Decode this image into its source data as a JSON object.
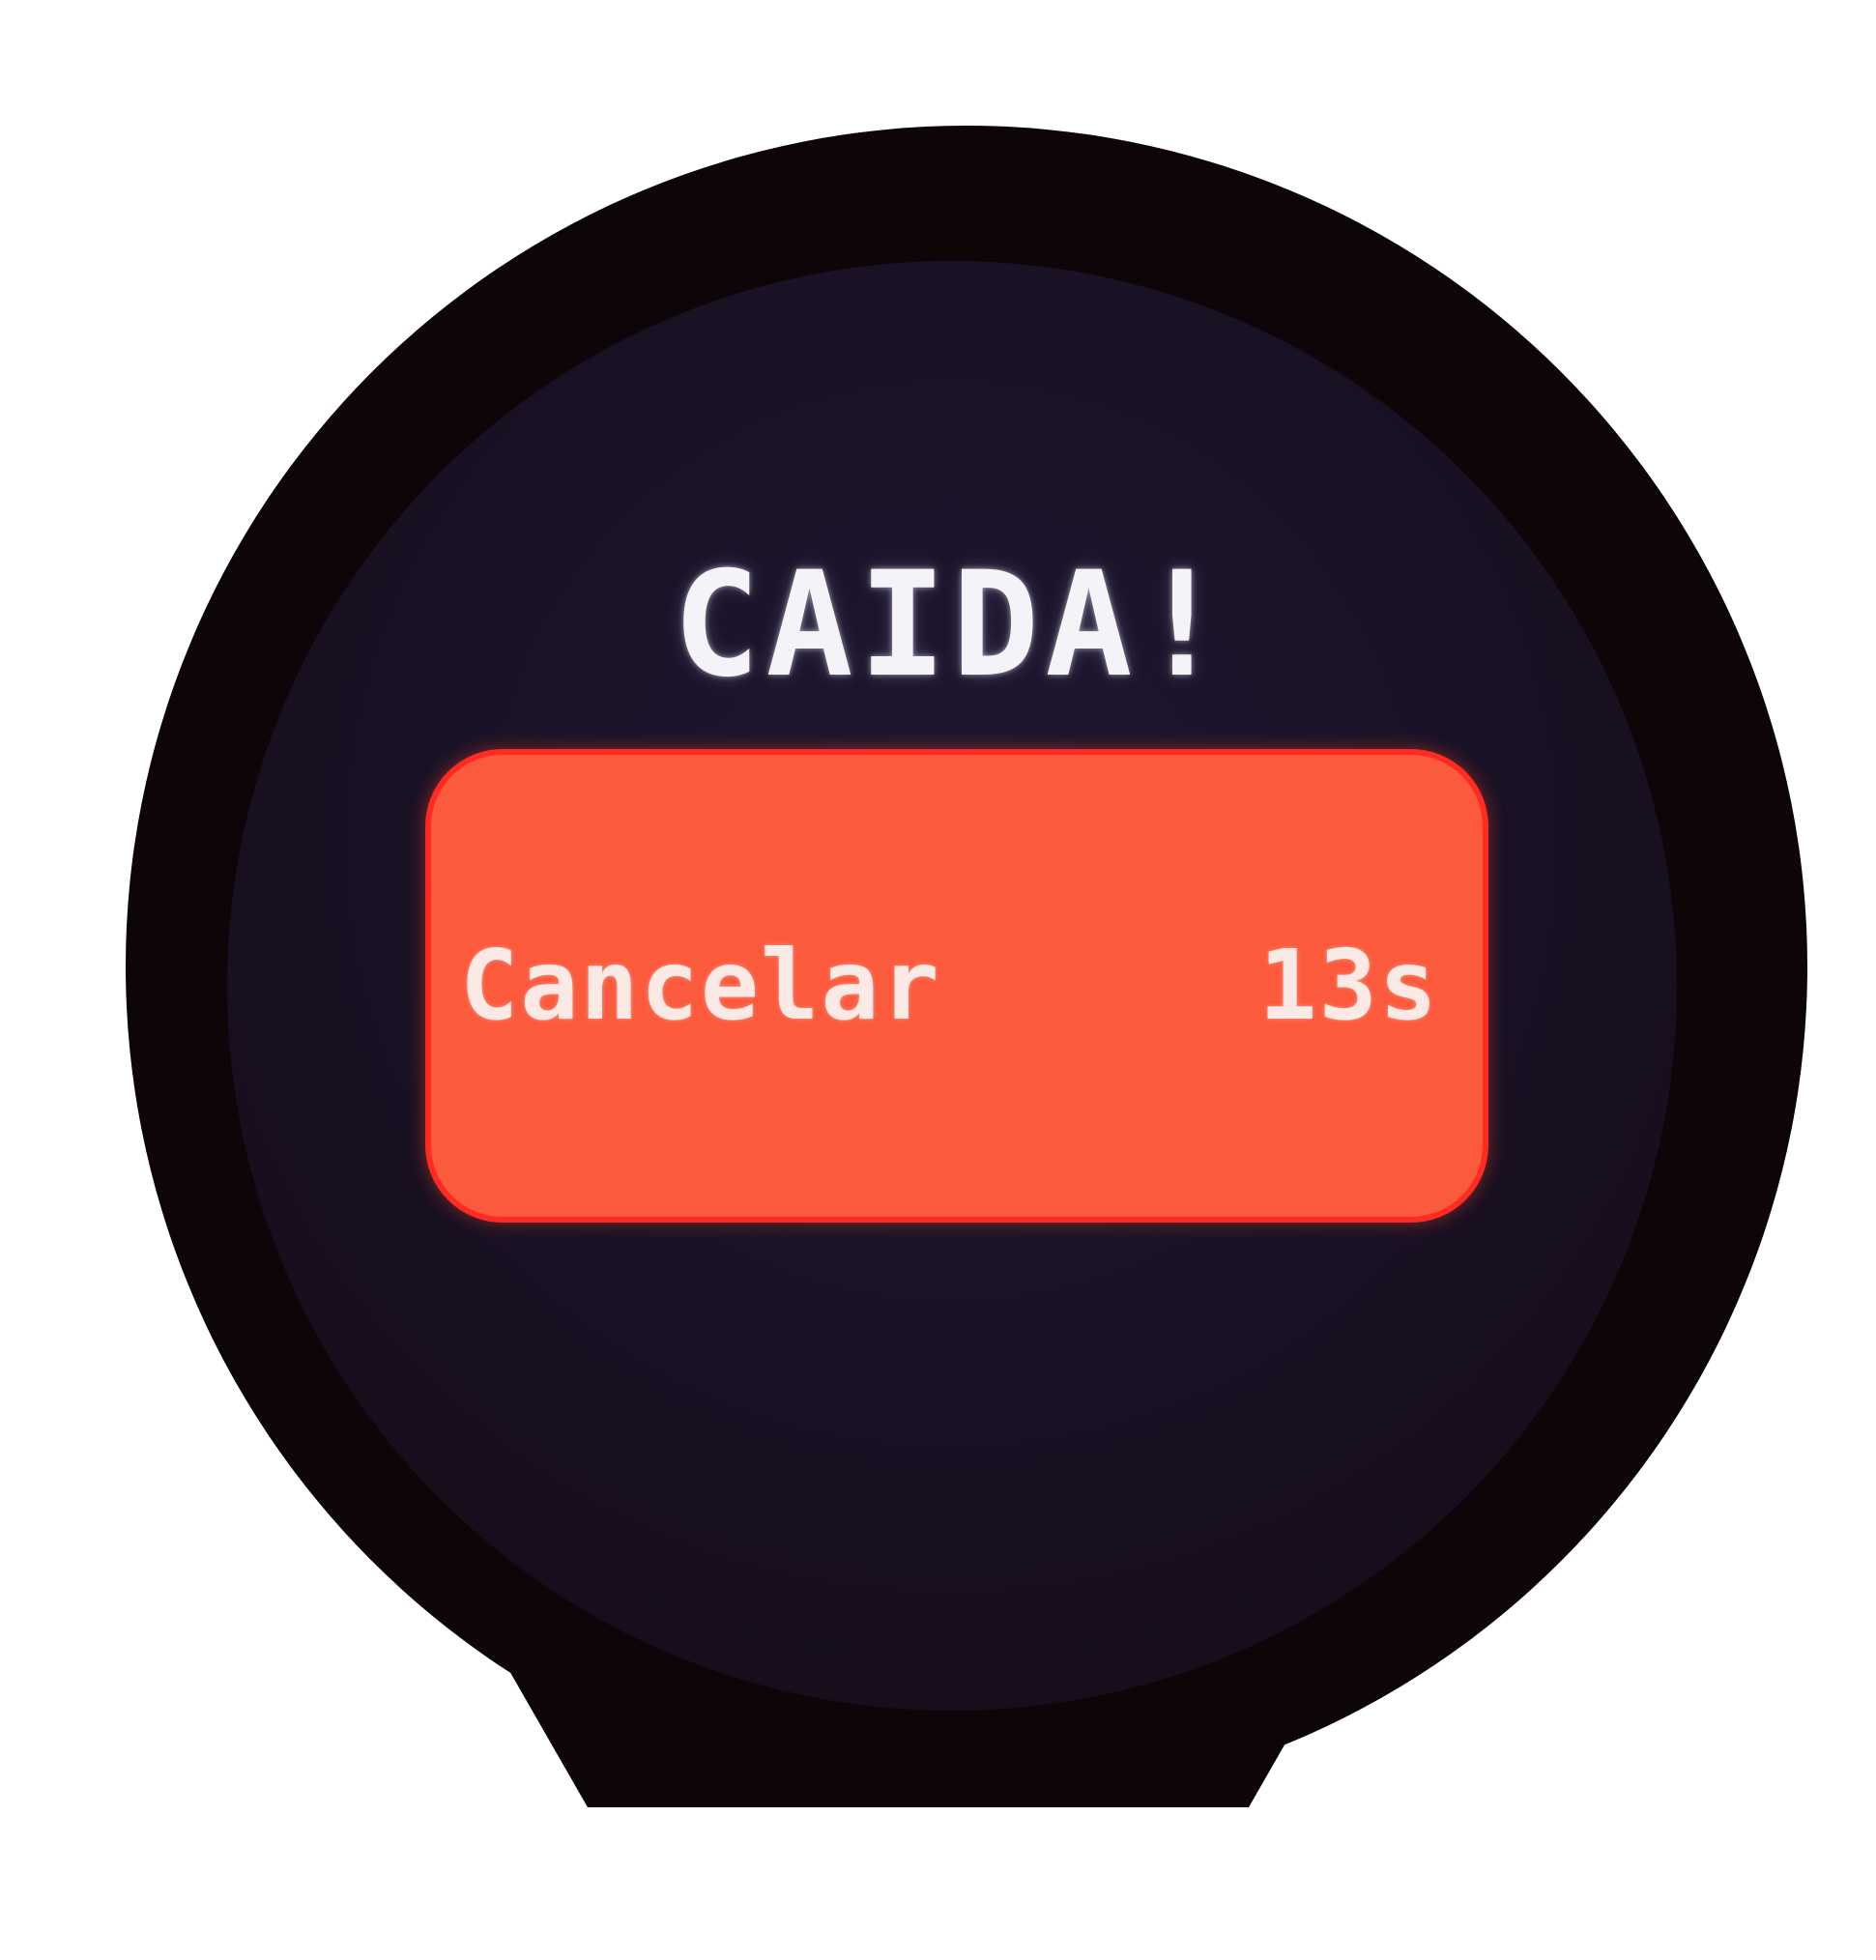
{
  "screen": {
    "title": "CAIDA!",
    "cancel_button": {
      "label": "Cancelar",
      "countdown": "13s"
    }
  },
  "colors": {
    "bezel": "#0d0508",
    "screen_background": "#1a1226",
    "title_text": "#f4f4f8",
    "button_fill": "#fb5a3c",
    "button_border": "#ff2a22",
    "button_text": "#fbe9e6"
  }
}
